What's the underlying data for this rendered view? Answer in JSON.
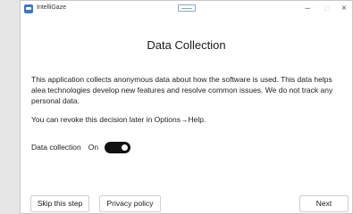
{
  "window": {
    "title": "IntelliGaze",
    "minimize_glyph": "–",
    "maximize_glyph": "□",
    "close_glyph": "×"
  },
  "page": {
    "heading": "Data Collection",
    "paragraph1": "This application collects anonymous data about how the software is used. This data helps alea technologies develop new features and resolve common issues. We do not track any personal data.",
    "paragraph2": "You can revoke this decision later in Options→Help."
  },
  "toggle": {
    "label": "Data collection",
    "state": "On",
    "on": true
  },
  "buttons": {
    "skip": "Skip this step",
    "privacy": "Privacy policy",
    "next": "Next"
  },
  "colors": {
    "toggle_on": "#111111",
    "app_icon": "#3b78c4"
  }
}
